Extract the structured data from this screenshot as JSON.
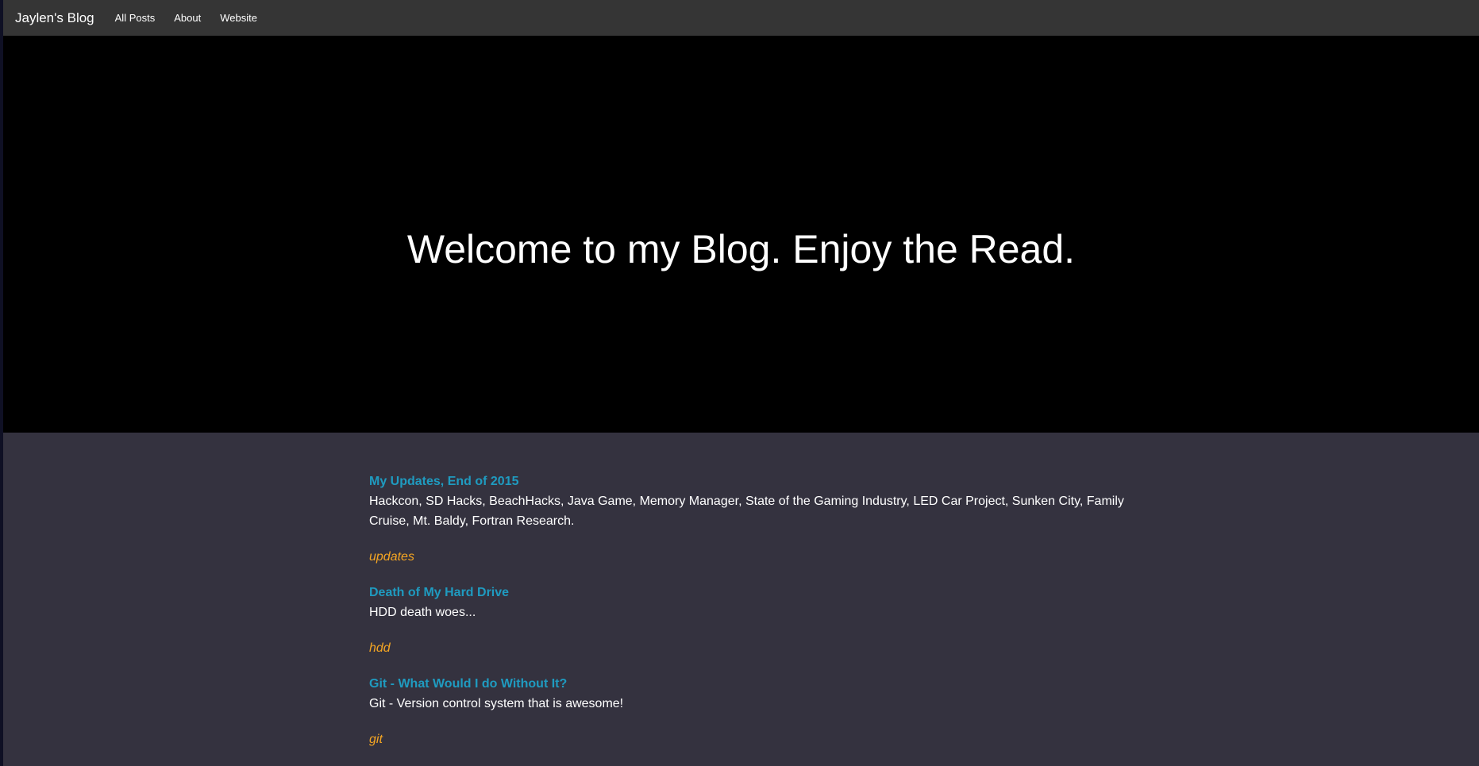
{
  "navbar": {
    "brand": "Jaylen's Blog",
    "links": [
      "All Posts",
      "About",
      "Website"
    ]
  },
  "hero": {
    "title": "Welcome to my Blog. Enjoy the Read."
  },
  "posts": [
    {
      "title": "My Updates, End of 2015",
      "excerpt": "Hackcon, SD Hacks, BeachHacks, Java Game, Memory Manager, State of the Gaming Industry, LED Car Project, Sunken City, Family Cruise, Mt. Baldy, Fortran Research.",
      "tag": "updates"
    },
    {
      "title": "Death of My Hard Drive",
      "excerpt": "HDD death woes...",
      "tag": "hdd"
    },
    {
      "title": "Git - What Would I do Without It?",
      "excerpt": "Git - Version control system that is awesome!",
      "tag": "git"
    }
  ],
  "colors": {
    "navbar_bg": "#353535",
    "hero_bg": "#000000",
    "content_bg": "#34323f",
    "post_title": "#1f9bc0",
    "post_tag": "#f5a623"
  }
}
